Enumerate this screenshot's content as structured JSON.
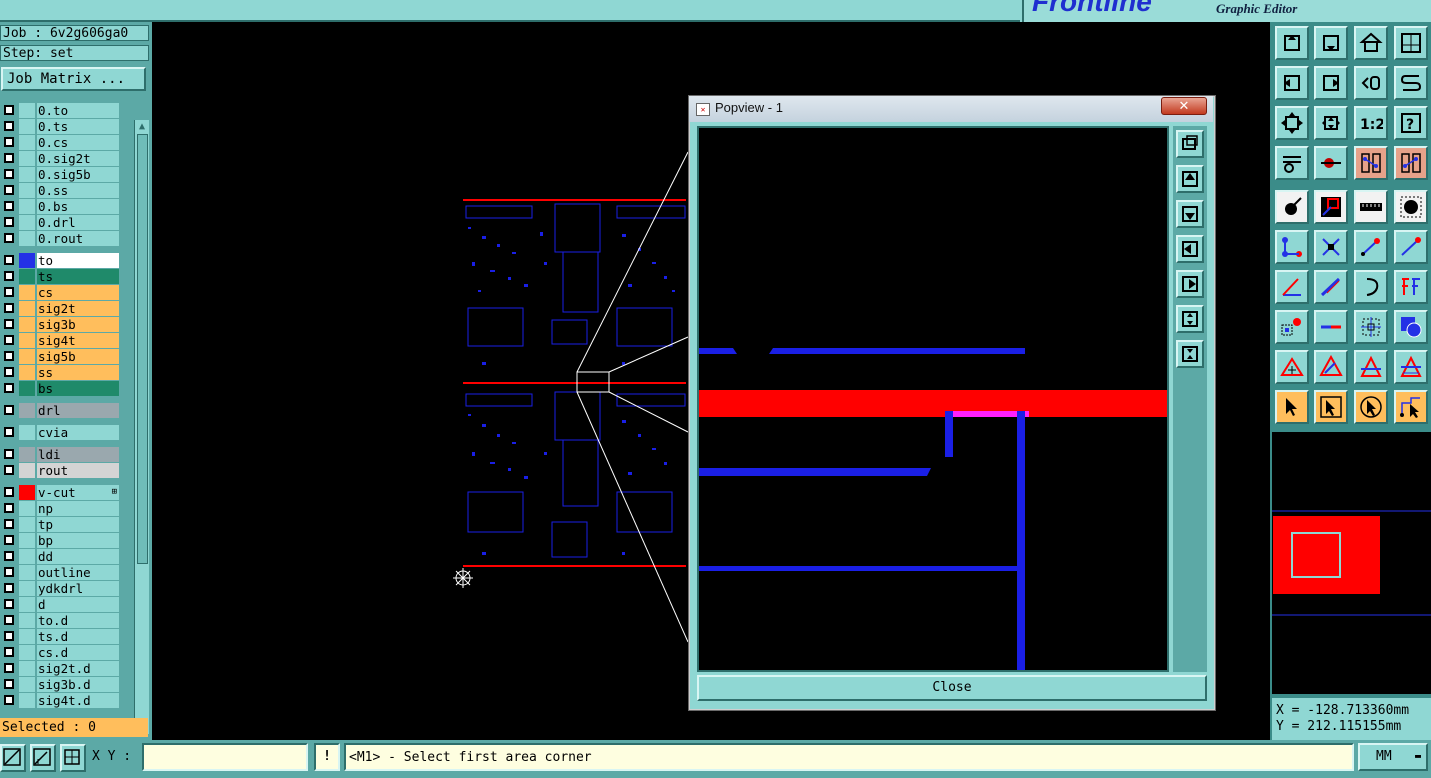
{
  "app": {
    "subtitle": "Graphic Editor",
    "brand": "Frontline"
  },
  "job": {
    "job_line": "Job : 6v2g606ga0",
    "step_line": "Step: set",
    "matrix_button": "Job Matrix ..."
  },
  "layers": [
    {
      "name": "0.to",
      "color": "#8fd7d3",
      "swatch": ""
    },
    {
      "name": "0.ts",
      "color": "#8fd7d3",
      "swatch": ""
    },
    {
      "name": "0.cs",
      "color": "#8fd7d3",
      "swatch": ""
    },
    {
      "name": "0.sig2t",
      "color": "#8fd7d3",
      "swatch": ""
    },
    {
      "name": "0.sig5b",
      "color": "#8fd7d3",
      "swatch": ""
    },
    {
      "name": "0.ss",
      "color": "#8fd7d3",
      "swatch": ""
    },
    {
      "name": "0.bs",
      "color": "#8fd7d3",
      "swatch": ""
    },
    {
      "name": "0.drl",
      "color": "#8fd7d3",
      "swatch": ""
    },
    {
      "name": "0.rout",
      "color": "#8fd7d3",
      "swatch": ""
    },
    {
      "name": "to",
      "color": "#ffffff",
      "swatch": "#2431e6"
    },
    {
      "name": "ts",
      "color": "#1f8a6a",
      "swatch": ""
    },
    {
      "name": "cs",
      "color": "#ffbe5c",
      "swatch": ""
    },
    {
      "name": "sig2t",
      "color": "#ffbe5c",
      "swatch": ""
    },
    {
      "name": "sig3b",
      "color": "#ffbe5c",
      "swatch": ""
    },
    {
      "name": "sig4t",
      "color": "#ffbe5c",
      "swatch": ""
    },
    {
      "name": "sig5b",
      "color": "#ffbe5c",
      "swatch": ""
    },
    {
      "name": "ss",
      "color": "#ffbe5c",
      "swatch": ""
    },
    {
      "name": "bs",
      "color": "#1f8a6a",
      "swatch": ""
    },
    {
      "name": "drl",
      "color": "#9aa8ae",
      "swatch": ""
    },
    {
      "name": "cvia",
      "color": "#8fd7d3",
      "swatch": ""
    },
    {
      "name": "ldi",
      "color": "#9aa8ae",
      "swatch": ""
    },
    {
      "name": "rout",
      "color": "#d4d4d4",
      "swatch": ""
    },
    {
      "name": "v-cut",
      "color": "#8fd7d3",
      "swatch": "#ff0000"
    },
    {
      "name": "np",
      "color": "#8fd7d3",
      "swatch": ""
    },
    {
      "name": "tp",
      "color": "#8fd7d3",
      "swatch": ""
    },
    {
      "name": "bp",
      "color": "#8fd7d3",
      "swatch": ""
    },
    {
      "name": "dd",
      "color": "#8fd7d3",
      "swatch": ""
    },
    {
      "name": "outline",
      "color": "#8fd7d3",
      "swatch": ""
    },
    {
      "name": "ydkdrl",
      "color": "#8fd7d3",
      "swatch": ""
    },
    {
      "name": "d",
      "color": "#8fd7d3",
      "swatch": ""
    },
    {
      "name": "to.d",
      "color": "#8fd7d3",
      "swatch": ""
    },
    {
      "name": "ts.d",
      "color": "#8fd7d3",
      "swatch": ""
    },
    {
      "name": "cs.d",
      "color": "#8fd7d3",
      "swatch": ""
    },
    {
      "name": "sig2t.d",
      "color": "#8fd7d3",
      "swatch": ""
    },
    {
      "name": "sig3b.d",
      "color": "#8fd7d3",
      "swatch": ""
    },
    {
      "name": "sig4t.d",
      "color": "#8fd7d3",
      "swatch": ""
    }
  ],
  "selected": "Selected : 0",
  "popview": {
    "title": "Popview - 1",
    "close_label": "Close"
  },
  "coords": {
    "x": "X = -128.713360mm",
    "y": "Y = 212.115155mm"
  },
  "bottom": {
    "xy_label": "X Y :",
    "status": "<M1> - Select first area corner",
    "units": "MM",
    "excl": "!"
  },
  "colors": {
    "panel": "#8fd7d3",
    "active": "#ffbe5c",
    "trace": "#1a1fe6",
    "vcut": "#ff0000"
  }
}
